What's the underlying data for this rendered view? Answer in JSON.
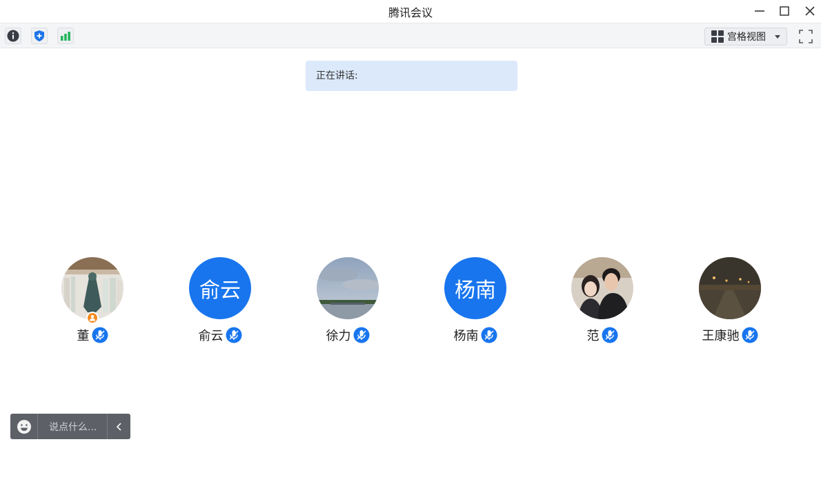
{
  "window": {
    "title": "腾讯会议"
  },
  "toolbar": {
    "info_icon": "info-icon",
    "security_icon": "shield-icon",
    "network_icon": "signal-bars-icon",
    "view_label": "宫格视图",
    "colors": {
      "shield": "#1e74e8",
      "signal": "#21b35c"
    }
  },
  "speaking_banner": {
    "label": "正在讲话:"
  },
  "participants": [
    {
      "name": "董",
      "avatar_type": "photo",
      "host": true
    },
    {
      "name": "俞云",
      "avatar_type": "text",
      "avatar_text": "俞云"
    },
    {
      "name": "徐力",
      "avatar_type": "photo"
    },
    {
      "name": "杨南",
      "avatar_type": "text",
      "avatar_text": "杨南"
    },
    {
      "name": "范",
      "avatar_type": "photo"
    },
    {
      "name": "王康驰",
      "avatar_type": "photo"
    }
  ],
  "chat": {
    "placeholder": "说点什么..."
  },
  "colors": {
    "accent": "#1875ee",
    "banner": "#dbe9fb",
    "chatbar": "#5d6066",
    "host": "#f58a1f"
  }
}
